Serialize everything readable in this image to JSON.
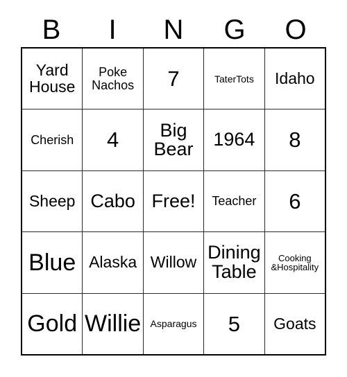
{
  "card": {
    "title": "Bingo Card",
    "header_letters": [
      "B",
      "I",
      "N",
      "G",
      "O"
    ],
    "colors": {
      "text": "#000000",
      "grid_line": "#2b2b2b",
      "outer_border": "#000000",
      "background": "#ffffff"
    },
    "free_space": "Free!",
    "rows": [
      [
        {
          "text": "Yard\nHouse",
          "size": "md"
        },
        {
          "text": "Poke\nNachos",
          "size": "sm"
        },
        {
          "text": "7",
          "size": "xl"
        },
        {
          "text": "TaterTots",
          "size": "xs"
        },
        {
          "text": "Idaho",
          "size": "md"
        }
      ],
      [
        {
          "text": "Cherish",
          "size": "sm"
        },
        {
          "text": "4",
          "size": "xl"
        },
        {
          "text": "Big\nBear",
          "size": "lg"
        },
        {
          "text": "1964",
          "size": "lg"
        },
        {
          "text": "8",
          "size": "xl"
        }
      ],
      [
        {
          "text": "Sheep",
          "size": "md"
        },
        {
          "text": "Cabo",
          "size": "lg"
        },
        {
          "text": "Free!",
          "size": "lg"
        },
        {
          "text": "Teacher",
          "size": "sm"
        },
        {
          "text": "6",
          "size": "xl"
        }
      ],
      [
        {
          "text": "Blue",
          "size": "xxl"
        },
        {
          "text": "Alaska",
          "size": "md"
        },
        {
          "text": "Willow",
          "size": "md"
        },
        {
          "text": "Dining\nTable",
          "size": "lg"
        },
        {
          "text": "Cooking\n&Hospitality",
          "size": "xxs"
        }
      ],
      [
        {
          "text": "Gold",
          "size": "xxl"
        },
        {
          "text": "Willie",
          "size": "xxl"
        },
        {
          "text": "Asparagus",
          "size": "xs"
        },
        {
          "text": "5",
          "size": "xl"
        },
        {
          "text": "Goats",
          "size": "md"
        }
      ]
    ]
  }
}
